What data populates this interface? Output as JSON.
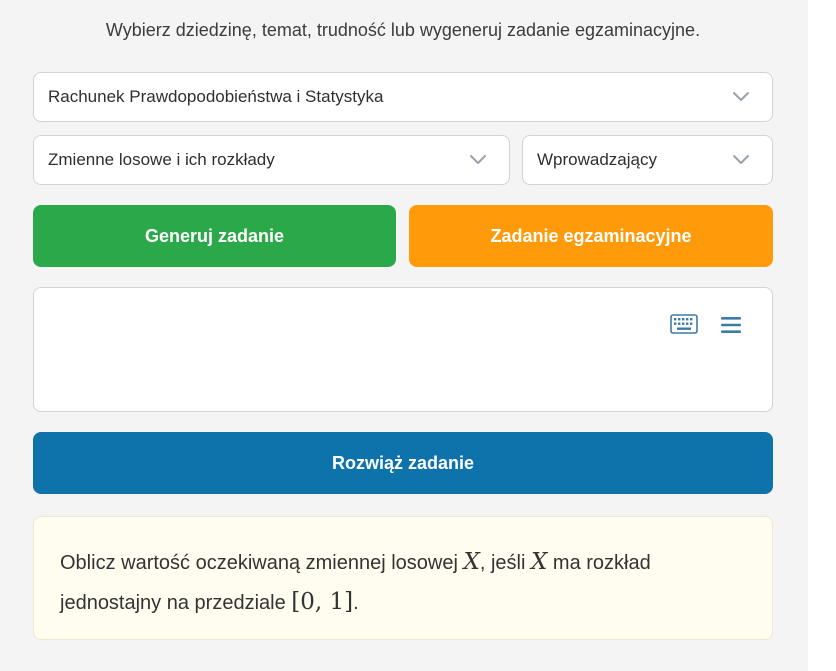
{
  "instruction": "Wybierz dziedzinę, temat, trudność lub wygeneruj zadanie egzaminacyjne.",
  "selects": {
    "domain": "Rachunek Prawdopodobieństwa i Statystyka",
    "topic": "Zmienne losowe i ich rozkłady",
    "difficulty": "Wprowadzający"
  },
  "buttons": {
    "generate": "Generuj zadanie",
    "exam": "Zadanie egzaminacyjne",
    "solve": "Rozwiąż zadanie"
  },
  "input": {
    "value": "",
    "icons": [
      "keyboard-icon",
      "menu-icon"
    ]
  },
  "problem": {
    "part1": "Oblicz wartość oczekiwaną zmiennej losowej ",
    "var1": "X",
    "part2": ", jeśli ",
    "var2": "X",
    "part3": " ma rozkład jednostajny na przedziale ",
    "interval": "[0, 1]",
    "part4": "."
  },
  "colors": {
    "generate": "#2ba84a",
    "exam": "#ff9a0a",
    "solve": "#0f73ab",
    "icon": "#3e7ca6",
    "problem_bg": "#fffdf0"
  }
}
